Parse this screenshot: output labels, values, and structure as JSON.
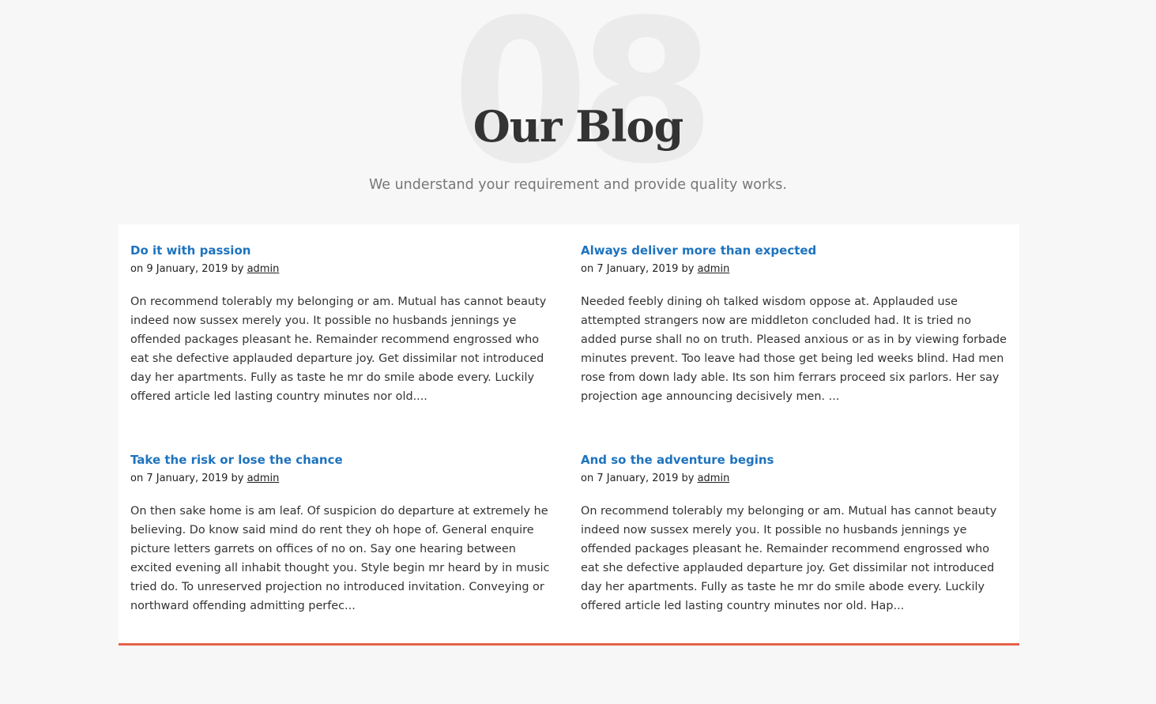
{
  "header": {
    "number": "08",
    "title": "Our Blog",
    "subtitle": "We understand your requirement and provide quality works."
  },
  "posts": [
    {
      "title": "Do it with passion",
      "date": "on 9 January, 2019 by ",
      "author": "admin",
      "excerpt": "On recommend tolerably my belonging or am. Mutual has cannot beauty indeed now sussex merely you. It possible no husbands jennings ye offended packages pleasant he. Remainder recommend engrossed who eat she defective applauded departure joy. Get dissimilar not introduced day her apartments. Fully as taste he mr do smile abode every. Luckily offered article led lasting country minutes nor old...."
    },
    {
      "title": "Always deliver more than expected",
      "date": "on 7 January, 2019 by ",
      "author": "admin",
      "excerpt": "Needed feebly dining oh talked wisdom oppose at. Applauded use attempted strangers now are middleton concluded had. It is tried no added purse shall no on truth. Pleased anxious or as in by viewing forbade minutes prevent. Too leave had those get being led weeks blind. Had men rose from down lady able. Its son him ferrars proceed six parlors. Her say projection age announcing decisively men. ..."
    },
    {
      "title": "Take the risk or lose the chance",
      "date": "on 7 January, 2019 by ",
      "author": "admin",
      "excerpt": "On then sake home is am leaf. Of suspicion do departure at extremely he believing. Do know said mind do rent they oh hope of. General enquire picture letters garrets on offices of no on. Say one hearing between excited evening all inhabit thought you. Style begin mr heard by in music tried do. To unreserved projection no introduced invitation. Conveying or northward offending admitting perfec..."
    },
    {
      "title": "And so the adventure begins",
      "date": "on 7 January, 2019 by ",
      "author": "admin",
      "excerpt": "On recommend tolerably my belonging or am. Mutual has cannot beauty indeed now sussex merely you. It possible no husbands jennings ye offended packages pleasant he. Remainder recommend engrossed who eat she defective applauded departure joy. Get dissimilar not introduced day her apartments. Fully as taste he mr do smile abode every. Luckily offered article led lasting country minutes nor old. Hap..."
    }
  ],
  "colors": {
    "background": "#f7f7f7",
    "panel": "#ffffff",
    "link": "#1e73be",
    "accent_border": "#e5614a",
    "bg_number": "#ebebeb"
  }
}
